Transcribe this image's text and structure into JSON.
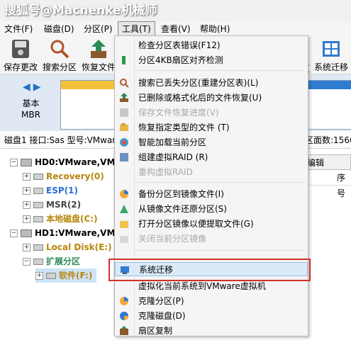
{
  "watermark": "搜狐号@Macnenke机械师",
  "menubar": [
    "文件(F)",
    "磁盘(D)",
    "分区(P)",
    "工具(T)",
    "查看(V)",
    "帮助(H)"
  ],
  "toolbar": {
    "save": "保存更改",
    "search": "搜索分区",
    "restore": "恢复文件",
    "truncated": "区",
    "migrate": "系统迁移"
  },
  "disk_panel": {
    "type_line1": "基本",
    "type_line2": "MBR"
  },
  "info": {
    "left": "磁盘1 接口:Sas  型号:VMwar",
    "right": "区面数:1566"
  },
  "tree": {
    "hd0": "HD0:VMware,VMw",
    "recovery": "Recovery(0)",
    "esp": "ESP(1)",
    "msr": "MSR(2)",
    "local_c": "本地磁盘(C:)",
    "hd1": "HD1:VMware,VMw",
    "local_e": "Local Disk(E:)",
    "extended": "扩展分区",
    "software": "软件(F:)"
  },
  "right": {
    "tab": "编辑",
    "col": "序号"
  },
  "tools_menu": [
    {
      "label": "检查分区表错误(F12)",
      "disabled": false,
      "icon": "check-table-icon"
    },
    {
      "label": "分区4KB扇区对齐检测",
      "disabled": false,
      "icon": "align-icon"
    },
    {
      "label": "搜索已丢失分区(重建分区表)(L)",
      "disabled": false,
      "icon": "search-icon"
    },
    {
      "label": "已删除或格式化后的文件恢复(U)",
      "disabled": false,
      "icon": "recover-icon"
    },
    {
      "label": "保存文件恢复进度(V)",
      "disabled": true,
      "icon": "save-progress-icon"
    },
    {
      "label": "恢复指定类型的文件 (T)",
      "disabled": false,
      "icon": "filetype-icon"
    },
    {
      "label": "智能加载当前分区",
      "disabled": false,
      "icon": "smart-load-icon"
    },
    {
      "label": "组建虚拟RAID (R)",
      "disabled": false,
      "icon": "raid-icon"
    },
    {
      "label": "重构虚拟RAID",
      "disabled": true,
      "icon": "rebuild-raid-icon"
    },
    {
      "label": "备份分区到镜像文件(I)",
      "disabled": false,
      "icon": "backup-icon"
    },
    {
      "label": "从镜像文件还原分区(S)",
      "disabled": false,
      "icon": "restore-image-icon"
    },
    {
      "label": "打开分区镜像以便提取文件(G)",
      "disabled": false,
      "icon": "open-image-icon"
    },
    {
      "label": "关闭当前分区镜像",
      "disabled": true,
      "icon": "close-image-icon"
    },
    {
      "label": "系统迁移",
      "disabled": false,
      "icon": "migrate-icon"
    },
    {
      "label": "虚拟化当前系统到VMware虚拟机",
      "disabled": false,
      "icon": "vmware-icon"
    },
    {
      "label": "克隆分区(P)",
      "disabled": false,
      "icon": "clone-partition-icon"
    },
    {
      "label": "克隆磁盘(D)",
      "disabled": false,
      "icon": "clone-disk-icon"
    },
    {
      "label": "扇区复制",
      "disabled": false,
      "icon": "sector-copy-icon"
    }
  ],
  "colors": {
    "recovery": "#b8860b",
    "esp": "#2b6cd4",
    "msr": "#444444",
    "local_c": "#b8860b",
    "local_e": "#b8860b",
    "extended": "#2e8b57",
    "software": "#b8860b",
    "highlight_box": "#d32f2f"
  }
}
